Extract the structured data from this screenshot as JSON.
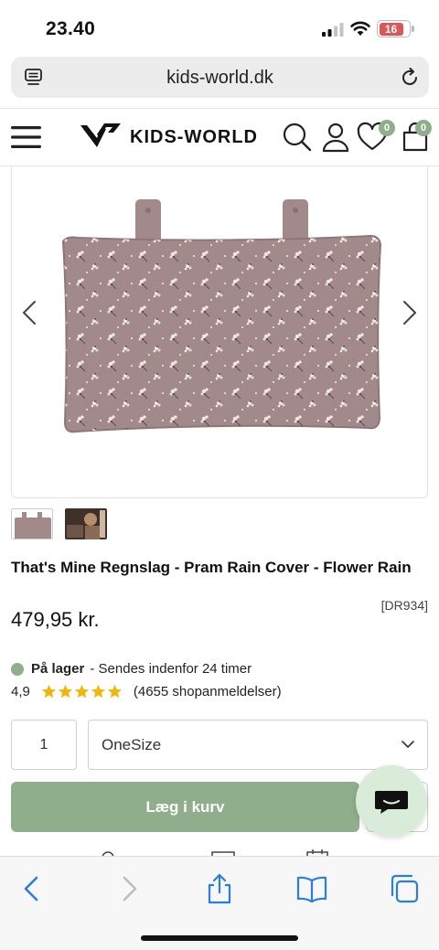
{
  "status_bar": {
    "time": "23.40",
    "battery": "16"
  },
  "browser": {
    "url": "kids-world.dk"
  },
  "header": {
    "logo_text": "KIDS-WORLD",
    "wishlist_count": "0",
    "cart_count": "0"
  },
  "product": {
    "title": "That's Mine Regnslag - Pram Rain Cover - Flower Rain",
    "sku": "[DR934]",
    "price": "479,95 kr.",
    "stock_status": "På lager",
    "shipping_note": "- Sendes indenfor 24 timer",
    "rating": "4,9",
    "review_count": "(4655 shopanmeldelser)",
    "stars": 5,
    "quantity": "1",
    "size": "OneSize",
    "add_to_cart": "Læg i kurv"
  },
  "colors": {
    "accent": "#8fae8b",
    "chat_bg": "#d9ecd9",
    "product_fabric": "#a28a8b",
    "battery_red": "#d55555"
  },
  "icons": [
    "reader-icon",
    "reload-icon",
    "menu-icon",
    "search-icon",
    "account-icon",
    "heart-icon",
    "cart-icon",
    "chevron-left-icon",
    "chevron-right-icon",
    "chevron-down-icon",
    "star-icon",
    "chat-icon",
    "back-icon",
    "forward-icon",
    "share-icon",
    "bookmarks-icon",
    "tabs-icon"
  ]
}
